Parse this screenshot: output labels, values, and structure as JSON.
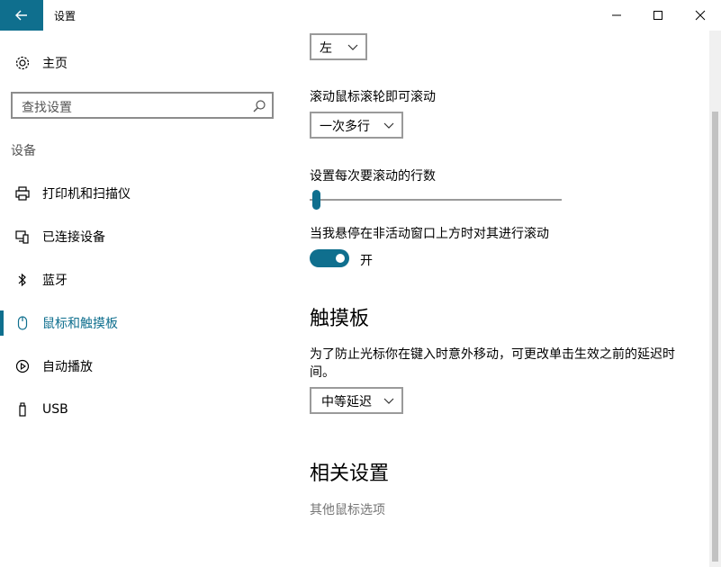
{
  "window": {
    "title": "设置"
  },
  "sidebar": {
    "home_label": "主页",
    "search": {
      "placeholder": "查找设置"
    },
    "section_label": "设备",
    "items": [
      {
        "label": "打印机和扫描仪",
        "icon": "printer-icon"
      },
      {
        "label": "已连接设备",
        "icon": "connected-devices-icon"
      },
      {
        "label": "蓝牙",
        "icon": "bluetooth-icon"
      },
      {
        "label": "鼠标和触摸板",
        "icon": "mouse-icon",
        "active": true
      },
      {
        "label": "自动播放",
        "icon": "autoplay-icon"
      },
      {
        "label": "USB",
        "icon": "usb-icon"
      }
    ]
  },
  "main": {
    "primary_button_dropdown": {
      "value": "左"
    },
    "scroll_wheel": {
      "label": "滚动鼠标滚轮即可滚动",
      "value": "一次多行"
    },
    "lines_to_scroll": {
      "label": "设置每次要滚动的行数",
      "value_fraction": 0.03
    },
    "inactive_scroll": {
      "label": "当我悬停在非活动窗口上方时对其进行滚动",
      "toggle_state": "开",
      "on": true
    },
    "touchpad": {
      "heading": "触摸板",
      "description": "为了防止光标你在键入时意外移动，可更改单击生效之前的延迟时间。",
      "delay_value": "中等延迟"
    },
    "related": {
      "heading": "相关设置",
      "link": "其他鼠标选项"
    }
  },
  "colors": {
    "accent": "#0f6f8e",
    "muted": "#767676"
  }
}
